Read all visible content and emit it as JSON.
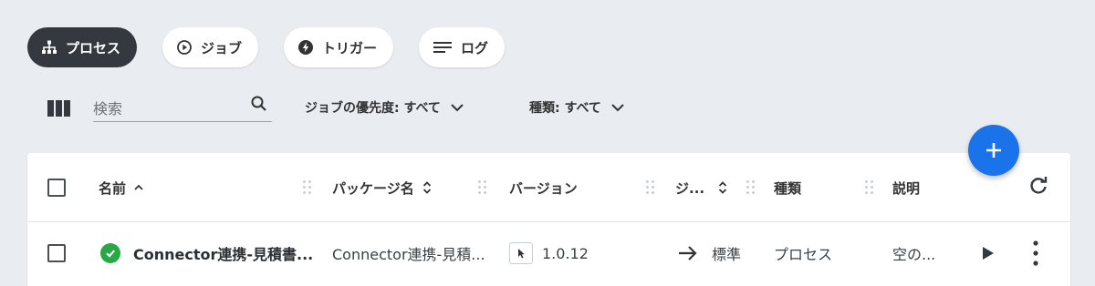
{
  "tabs": [
    {
      "label": "プロセス",
      "icon": "sitemap-icon",
      "active": true
    },
    {
      "label": "ジョブ",
      "icon": "play-circle-icon",
      "active": false
    },
    {
      "label": "トリガー",
      "icon": "bolt-icon",
      "active": false
    },
    {
      "label": "ログ",
      "icon": "list-lines-icon",
      "active": false
    }
  ],
  "filters": {
    "search_placeholder": "検索",
    "priority_label": "ジョブの優先度: すべて",
    "type_label": "種類: すべて"
  },
  "table": {
    "columns": {
      "name": "名前",
      "package": "パッケージ名",
      "version": "バージョン",
      "job": "ジ...",
      "type": "種類",
      "description": "説明"
    },
    "rows": [
      {
        "name": "Connector連携-見積書...",
        "package": "Connector連携-見積...",
        "version": "1.0.12",
        "job": "標準",
        "type": "プロセス",
        "description": "空の...",
        "status": "success"
      }
    ]
  },
  "colors": {
    "background": "#e9edf2",
    "active_chip": "#33393f",
    "fab": "#1a73e8",
    "success": "#28a745"
  }
}
